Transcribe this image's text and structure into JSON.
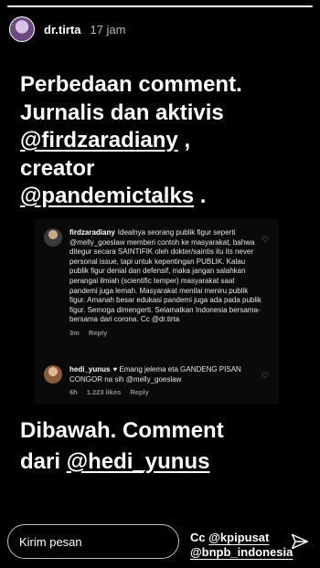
{
  "story": {
    "progress": 1.0
  },
  "header": {
    "username": "dr.tirta",
    "time": "17 jam"
  },
  "headline": {
    "line1": "Perbedaan comment.",
    "line2": "Jurnalis dan aktivis",
    "mention1": "@firdzaradiany",
    "line3_suffix": " ,",
    "line4": "creator",
    "mention2": "@pandemictalks",
    "line5_suffix": " ."
  },
  "comments": [
    {
      "user": "firdzaradiany",
      "text": "Idealnya seorang publik figur seperti @melly_goeslaw memberi contoh ke masyarakat, bahwa ditegur secara SAINTIFIK oleh dokter/saintis itu its never personal issue, tapi untuk kepentingan PUBLIK. Kalau publik figur denial dan defensif, maka jangan salahkan perangai ilmiah (scientific temper) masyarakat saat pandemi juga lemah. Masyarakat menilai meniru publik figur. Amanah besar edukasi pandemi juga ada pada publik figur. Semoga dimengerti. Selamatkan Indonesia bersama-bersama dari corona. Cc @dr.tirta",
      "age": "3m",
      "likes": "",
      "reply": "Reply"
    },
    {
      "user": "hedi_yunus",
      "text": "♥ Emang jelema eta GANDENG PISAN CONGOR na sih @melly_goeslaw",
      "age": "6h",
      "likes": "1.223 likes",
      "reply": "Reply"
    }
  ],
  "subheadline": {
    "line1": "Dibawah. Comment",
    "prefix": "dari ",
    "mention": "@hedi_yunus"
  },
  "reply_bar": {
    "placeholder": "Kirim pesan"
  },
  "cc": {
    "prefix": "Cc ",
    "mention1": "@kpipusat",
    "mention2": "@bnpb_indonesia"
  }
}
